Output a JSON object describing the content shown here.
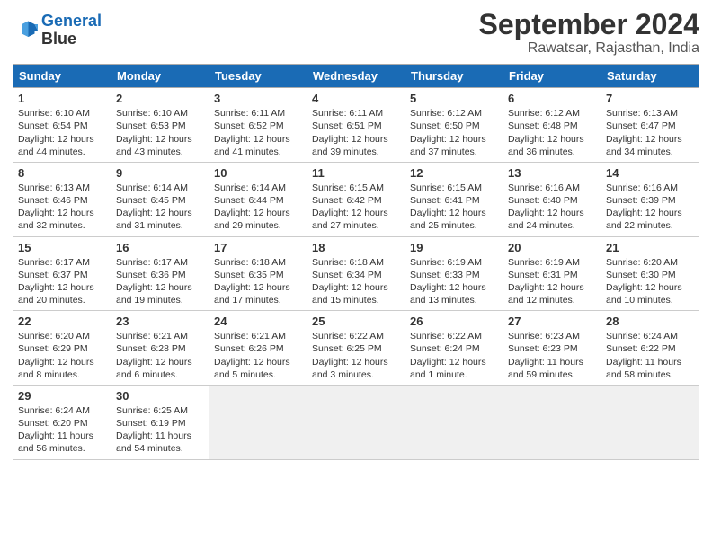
{
  "header": {
    "logo_line1": "General",
    "logo_line2": "Blue",
    "month": "September 2024",
    "location": "Rawatsar, Rajasthan, India"
  },
  "days_of_week": [
    "Sunday",
    "Monday",
    "Tuesday",
    "Wednesday",
    "Thursday",
    "Friday",
    "Saturday"
  ],
  "weeks": [
    [
      {
        "day": "1",
        "lines": [
          "Sunrise: 6:10 AM",
          "Sunset: 6:54 PM",
          "Daylight: 12 hours",
          "and 44 minutes."
        ]
      },
      {
        "day": "2",
        "lines": [
          "Sunrise: 6:10 AM",
          "Sunset: 6:53 PM",
          "Daylight: 12 hours",
          "and 43 minutes."
        ]
      },
      {
        "day": "3",
        "lines": [
          "Sunrise: 6:11 AM",
          "Sunset: 6:52 PM",
          "Daylight: 12 hours",
          "and 41 minutes."
        ]
      },
      {
        "day": "4",
        "lines": [
          "Sunrise: 6:11 AM",
          "Sunset: 6:51 PM",
          "Daylight: 12 hours",
          "and 39 minutes."
        ]
      },
      {
        "day": "5",
        "lines": [
          "Sunrise: 6:12 AM",
          "Sunset: 6:50 PM",
          "Daylight: 12 hours",
          "and 37 minutes."
        ]
      },
      {
        "day": "6",
        "lines": [
          "Sunrise: 6:12 AM",
          "Sunset: 6:48 PM",
          "Daylight: 12 hours",
          "and 36 minutes."
        ]
      },
      {
        "day": "7",
        "lines": [
          "Sunrise: 6:13 AM",
          "Sunset: 6:47 PM",
          "Daylight: 12 hours",
          "and 34 minutes."
        ]
      }
    ],
    [
      {
        "day": "8",
        "lines": [
          "Sunrise: 6:13 AM",
          "Sunset: 6:46 PM",
          "Daylight: 12 hours",
          "and 32 minutes."
        ]
      },
      {
        "day": "9",
        "lines": [
          "Sunrise: 6:14 AM",
          "Sunset: 6:45 PM",
          "Daylight: 12 hours",
          "and 31 minutes."
        ]
      },
      {
        "day": "10",
        "lines": [
          "Sunrise: 6:14 AM",
          "Sunset: 6:44 PM",
          "Daylight: 12 hours",
          "and 29 minutes."
        ]
      },
      {
        "day": "11",
        "lines": [
          "Sunrise: 6:15 AM",
          "Sunset: 6:42 PM",
          "Daylight: 12 hours",
          "and 27 minutes."
        ]
      },
      {
        "day": "12",
        "lines": [
          "Sunrise: 6:15 AM",
          "Sunset: 6:41 PM",
          "Daylight: 12 hours",
          "and 25 minutes."
        ]
      },
      {
        "day": "13",
        "lines": [
          "Sunrise: 6:16 AM",
          "Sunset: 6:40 PM",
          "Daylight: 12 hours",
          "and 24 minutes."
        ]
      },
      {
        "day": "14",
        "lines": [
          "Sunrise: 6:16 AM",
          "Sunset: 6:39 PM",
          "Daylight: 12 hours",
          "and 22 minutes."
        ]
      }
    ],
    [
      {
        "day": "15",
        "lines": [
          "Sunrise: 6:17 AM",
          "Sunset: 6:37 PM",
          "Daylight: 12 hours",
          "and 20 minutes."
        ]
      },
      {
        "day": "16",
        "lines": [
          "Sunrise: 6:17 AM",
          "Sunset: 6:36 PM",
          "Daylight: 12 hours",
          "and 19 minutes."
        ]
      },
      {
        "day": "17",
        "lines": [
          "Sunrise: 6:18 AM",
          "Sunset: 6:35 PM",
          "Daylight: 12 hours",
          "and 17 minutes."
        ]
      },
      {
        "day": "18",
        "lines": [
          "Sunrise: 6:18 AM",
          "Sunset: 6:34 PM",
          "Daylight: 12 hours",
          "and 15 minutes."
        ]
      },
      {
        "day": "19",
        "lines": [
          "Sunrise: 6:19 AM",
          "Sunset: 6:33 PM",
          "Daylight: 12 hours",
          "and 13 minutes."
        ]
      },
      {
        "day": "20",
        "lines": [
          "Sunrise: 6:19 AM",
          "Sunset: 6:31 PM",
          "Daylight: 12 hours",
          "and 12 minutes."
        ]
      },
      {
        "day": "21",
        "lines": [
          "Sunrise: 6:20 AM",
          "Sunset: 6:30 PM",
          "Daylight: 12 hours",
          "and 10 minutes."
        ]
      }
    ],
    [
      {
        "day": "22",
        "lines": [
          "Sunrise: 6:20 AM",
          "Sunset: 6:29 PM",
          "Daylight: 12 hours",
          "and 8 minutes."
        ]
      },
      {
        "day": "23",
        "lines": [
          "Sunrise: 6:21 AM",
          "Sunset: 6:28 PM",
          "Daylight: 12 hours",
          "and 6 minutes."
        ]
      },
      {
        "day": "24",
        "lines": [
          "Sunrise: 6:21 AM",
          "Sunset: 6:26 PM",
          "Daylight: 12 hours",
          "and 5 minutes."
        ]
      },
      {
        "day": "25",
        "lines": [
          "Sunrise: 6:22 AM",
          "Sunset: 6:25 PM",
          "Daylight: 12 hours",
          "and 3 minutes."
        ]
      },
      {
        "day": "26",
        "lines": [
          "Sunrise: 6:22 AM",
          "Sunset: 6:24 PM",
          "Daylight: 12 hours",
          "and 1 minute."
        ]
      },
      {
        "day": "27",
        "lines": [
          "Sunrise: 6:23 AM",
          "Sunset: 6:23 PM",
          "Daylight: 11 hours",
          "and 59 minutes."
        ]
      },
      {
        "day": "28",
        "lines": [
          "Sunrise: 6:24 AM",
          "Sunset: 6:22 PM",
          "Daylight: 11 hours",
          "and 58 minutes."
        ]
      }
    ],
    [
      {
        "day": "29",
        "lines": [
          "Sunrise: 6:24 AM",
          "Sunset: 6:20 PM",
          "Daylight: 11 hours",
          "and 56 minutes."
        ]
      },
      {
        "day": "30",
        "lines": [
          "Sunrise: 6:25 AM",
          "Sunset: 6:19 PM",
          "Daylight: 11 hours",
          "and 54 minutes."
        ]
      },
      {
        "day": "",
        "lines": [],
        "empty": true
      },
      {
        "day": "",
        "lines": [],
        "empty": true
      },
      {
        "day": "",
        "lines": [],
        "empty": true
      },
      {
        "day": "",
        "lines": [],
        "empty": true
      },
      {
        "day": "",
        "lines": [],
        "empty": true
      }
    ]
  ]
}
